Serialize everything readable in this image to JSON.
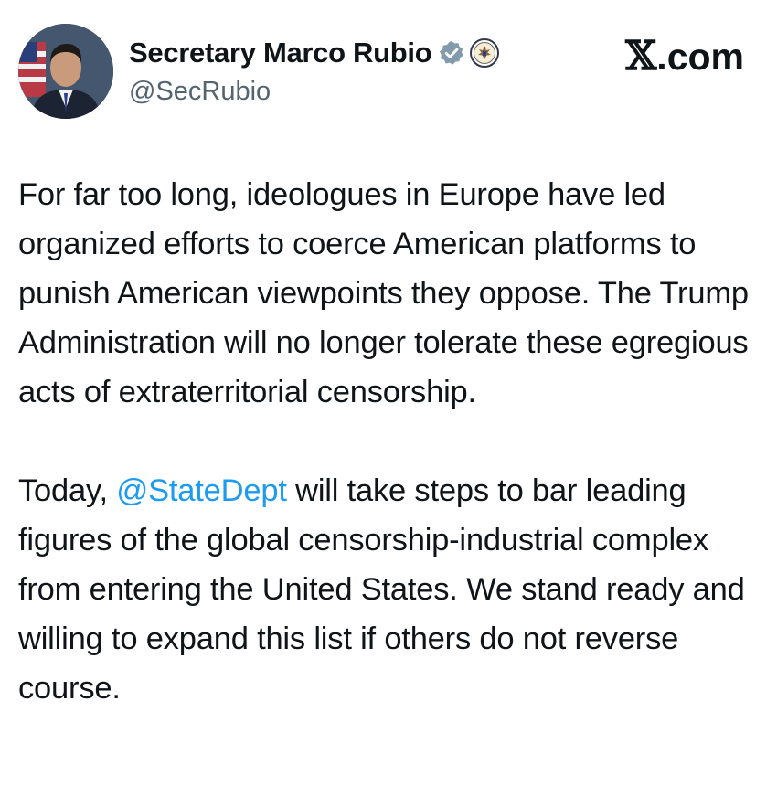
{
  "site": {
    "x_mark": "𝕏",
    "dot_com": ".com"
  },
  "author": {
    "display_name": "Secretary Marco Rubio",
    "handle": "@SecRubio",
    "verified_icon": "verified-badge-icon",
    "affiliation_icon": "state-department-seal-icon"
  },
  "post": {
    "paragraph_1": "For far too long, ideologues in Europe have led organized efforts to coerce American platforms to punish American viewpoints they oppose. The Trump Administration will no longer tolerate these egregious acts of extraterritorial censorship.",
    "paragraph_2_before": "Today, ",
    "paragraph_2_mention": "@StateDept",
    "paragraph_2_after": " will take steps to bar leading figures of the global censorship-industrial complex from entering the United States. We stand ready and willing to expand this list if others do not reverse course."
  },
  "colors": {
    "text": "#0f1419",
    "secondary_text": "#536471",
    "mention": "#1d9bf0",
    "badge_gray": "#829aab"
  }
}
